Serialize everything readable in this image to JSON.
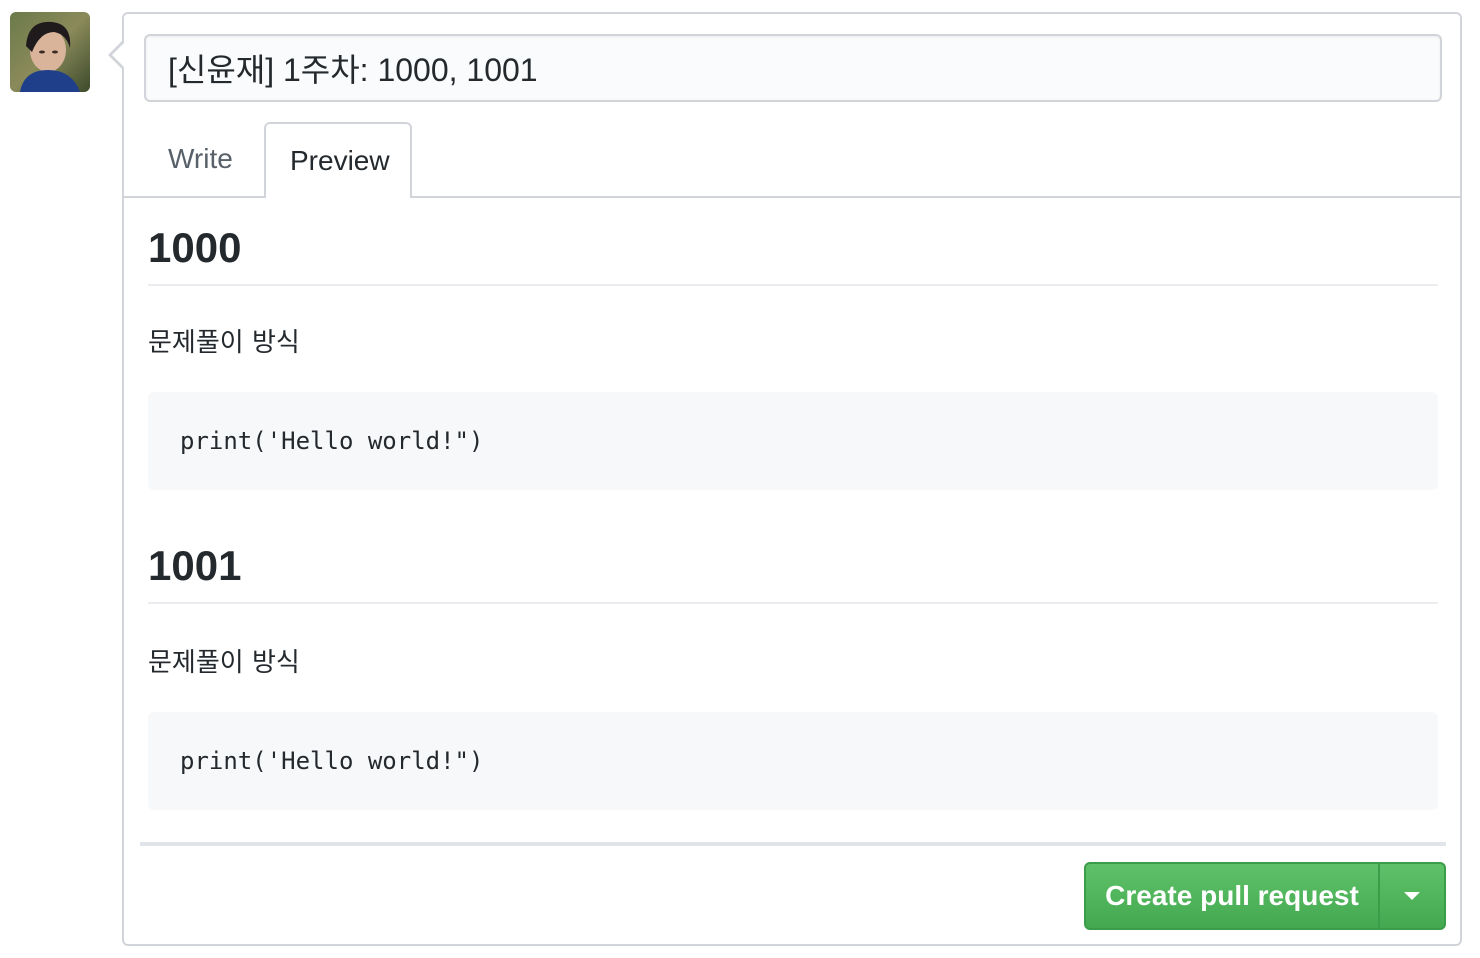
{
  "pr": {
    "title_value": "[신윤재] 1주차: 1000, 1001"
  },
  "tabs": {
    "write": "Write",
    "preview": "Preview",
    "active": "preview"
  },
  "preview": {
    "sections": [
      {
        "heading": "1000",
        "paragraph": "문제풀이 방식",
        "code": "print('Hello world!\")"
      },
      {
        "heading": "1001",
        "paragraph": "문제풀이 방식",
        "code": "print('Hello world!\")"
      }
    ]
  },
  "actions": {
    "create_label": "Create pull request"
  },
  "colors": {
    "primary_green": "#4caf50",
    "border": "#d1d5da",
    "code_bg": "#f6f8fa"
  }
}
